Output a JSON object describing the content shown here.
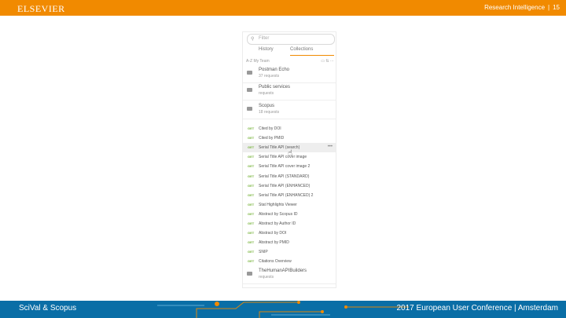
{
  "header": {
    "logo": "ELSEVIER",
    "right_text": "Research Intelligence",
    "sep": "|",
    "page_number": "15",
    "accent": "#f18a00"
  },
  "panel": {
    "search_icon": "search-icon",
    "search_placeholder": "Filter",
    "tabs": [
      {
        "label": "History",
        "active": false
      },
      {
        "label": "Collections",
        "active": true
      }
    ],
    "sort_label": "A-Z  My Team",
    "sort_icons": "▭ ⇅ ⋯",
    "folders_top": [
      {
        "name": "Postman Echo",
        "count": "37 requests"
      },
      {
        "name": "Public services",
        "count": "requests"
      },
      {
        "name": "Scopus",
        "count": "18 requests"
      }
    ],
    "requests": [
      {
        "method": "GET",
        "name": "Cited by DOI"
      },
      {
        "method": "GET",
        "name": "Cited by PMID"
      },
      {
        "method": "GET",
        "name": "Serial Title API (search)",
        "more": "•••"
      },
      {
        "method": "GET",
        "name": "Serial Title API cover image"
      },
      {
        "method": "GET",
        "name": "Serial Title API cover image 2"
      },
      {
        "method": "GET",
        "name": "Serial Title API (STANDARD)"
      },
      {
        "method": "GET",
        "name": "Serial Title API (ENHANCED)"
      },
      {
        "method": "GET",
        "name": "Serial Title API (ENHANCED) 2"
      },
      {
        "method": "GET",
        "name": "Stat Highlights Viewer"
      },
      {
        "method": "GET",
        "name": "Abstract by Scopus ID"
      },
      {
        "method": "GET",
        "name": "Abstract by Author ID"
      },
      {
        "method": "GET",
        "name": "Abstract by DOI"
      },
      {
        "method": "GET",
        "name": "Abstract by PMID"
      },
      {
        "method": "GET",
        "name": "SNIP"
      },
      {
        "method": "GET",
        "name": "Citations Overview"
      }
    ],
    "folders_bottom": [
      {
        "name": "TheHumanAPIBuilders",
        "count": "requests"
      }
    ]
  },
  "footer": {
    "left": "SciVal & Scopus",
    "right": "2017 European User Conference | Amsterdam",
    "color": "#0a6ea6"
  }
}
